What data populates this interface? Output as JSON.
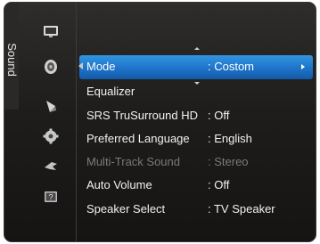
{
  "panel": {
    "category": "Sound"
  },
  "sidebar_icons": [
    {
      "name": "picture-icon"
    },
    {
      "name": "sound-icon"
    },
    {
      "name": "channel-icon"
    },
    {
      "name": "setup-icon"
    },
    {
      "name": "input-icon"
    },
    {
      "name": "support-icon",
      "glyph": "?"
    }
  ],
  "menu": {
    "items": [
      {
        "label": "Mode",
        "value": ": Costom",
        "state": "selected"
      },
      {
        "label": "Equalizer",
        "value": "",
        "state": "normal"
      },
      {
        "label": "SRS TruSurround HD",
        "value": ": Off",
        "state": "normal"
      },
      {
        "label": "Preferred Language",
        "value": ": English",
        "state": "normal"
      },
      {
        "label": "Multi-Track Sound",
        "value": ": Stereo",
        "state": "disabled"
      },
      {
        "label": "Auto Volume",
        "value": ": Off",
        "state": "normal"
      },
      {
        "label": "Speaker Select",
        "value": ": TV Speaker",
        "state": "normal"
      }
    ]
  },
  "colors": {
    "highlight": "#1e73c9",
    "background": "#1e1d1c",
    "text": "#f2f2f2",
    "disabled_text": "#7a7a7a"
  }
}
